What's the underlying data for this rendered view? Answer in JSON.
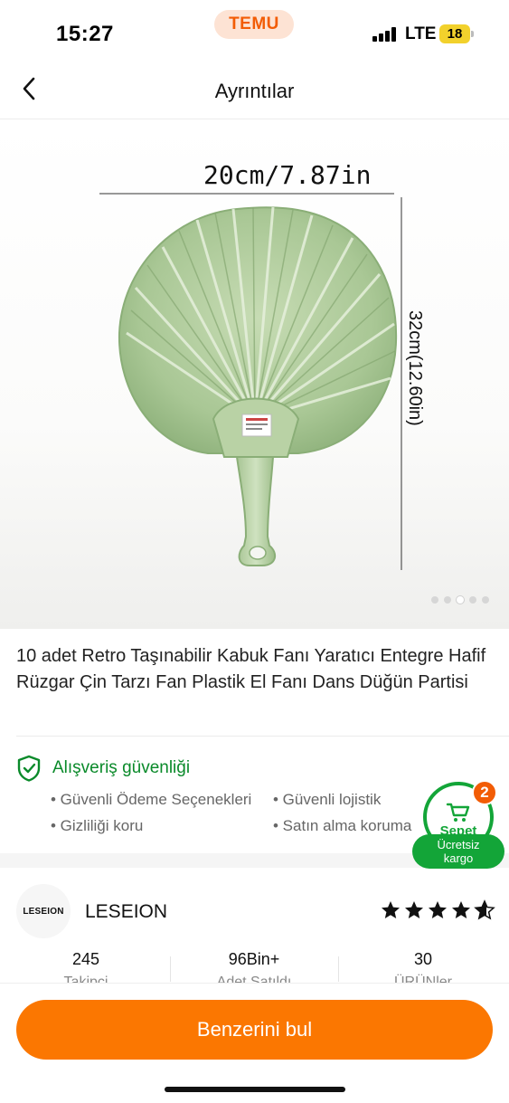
{
  "status_bar": {
    "time": "15:27",
    "app_badge": "TEMU",
    "network": "LTE",
    "battery": "18"
  },
  "nav": {
    "title": "Ayrıntılar"
  },
  "product_image": {
    "width_label": "20cm/7.87in",
    "height_label": "32cm(12.60in)",
    "carousel_total": 5,
    "carousel_active": 3
  },
  "product": {
    "title": "10 adet Retro Taşınabilir Kabuk Fanı Yaratıcı Entegre Hafif Rüzgar Çin Tarzı Fan Plastik El Fanı Dans Düğün Partisi"
  },
  "security": {
    "title": "Alışveriş güvenliği",
    "items": [
      "• Güvenli Ödeme Seçenekleri",
      "• Güvenli lojistik",
      "• Gizliliği koru",
      "• Satın alma koruma"
    ]
  },
  "cart": {
    "label": "Sepet",
    "count": "2",
    "shipping_line1": "Ücretsiz",
    "shipping_line2": "kargo"
  },
  "store": {
    "logo_text": "LESEION",
    "name": "LESEION",
    "rating": 4.5,
    "stats": [
      {
        "value": "245",
        "label": "Takipçi"
      },
      {
        "value": "96Bin+",
        "label": "Adet Satıldı"
      },
      {
        "value": "30",
        "label": "ÜRÜNler"
      }
    ]
  },
  "cta": {
    "label": "Benzerini bul"
  },
  "colors": {
    "brand_orange": "#fb7701",
    "security_green": "#0a8a2a",
    "cart_green": "#13a538",
    "temu_orange": "#f25c05"
  }
}
